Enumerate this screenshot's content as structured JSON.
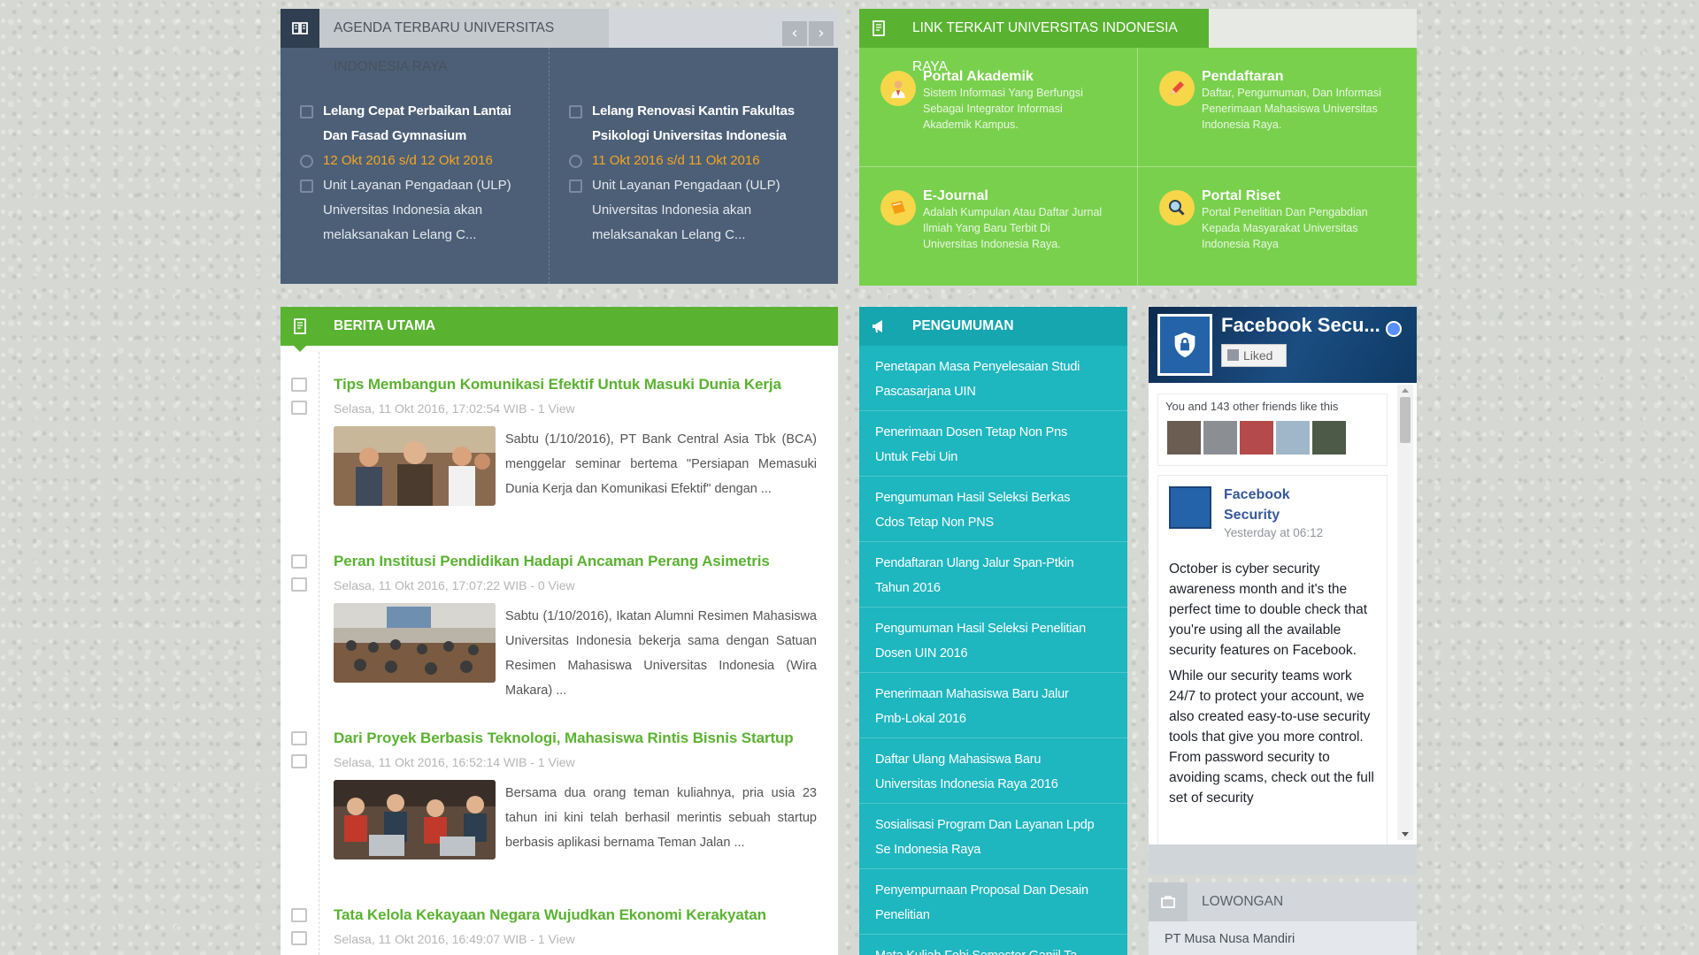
{
  "agenda": {
    "header": "AGENDA TERBARU UNIVERSITAS INDONESIA RAYA",
    "prev_icon": "‹",
    "next_icon": "›",
    "items": [
      {
        "title_line1": "Lelang Cepat Perbaikan Lantai",
        "title_line2": "Dan Fasad Gymnasium",
        "date": "12 Okt 2016 s/d 12 Okt 2016",
        "desc_line1": "Unit Layanan Pengadaan (ULP)",
        "desc_line2": "Universitas Indonesia akan",
        "desc_line3": "melaksanakan Lelang C..."
      },
      {
        "title_line1": "Lelang Renovasi Kantin Fakultas",
        "title_line2": "Psikologi Universitas Indonesia",
        "date": "11 Okt 2016 s/d 11 Okt 2016",
        "desc_line1": "Unit Layanan Pengadaan (ULP)",
        "desc_line2": "Universitas Indonesia akan",
        "desc_line3": "melaksanakan Lelang C..."
      }
    ]
  },
  "links": {
    "header": "LINK TERKAIT UNIVERSITAS INDONESIA RAYA",
    "items": [
      {
        "title": "Portal Akademik",
        "d1": "Sistem Informasi Yang Berfungsi",
        "d2": "Sebagai Integrator Informasi",
        "d3": "Akademik Kampus."
      },
      {
        "title": "Pendaftaran",
        "d1": "Daftar, Pengumuman, Dan Informasi",
        "d2": "Penerimaan Mahasiswa Universitas",
        "d3": "Indonesia Raya."
      },
      {
        "title": "E-Journal",
        "d1": "Adalah Kumpulan Atau Daftar Jurnal",
        "d2": "Ilmiah Yang Baru Terbit Di",
        "d3": "Universitas Indonesia Raya."
      },
      {
        "title": "Portal Riset",
        "d1": "Portal Penelitian Dan Pengabdian",
        "d2": "Kepada Masyarakat Universitas",
        "d3": "Indonesia Raya"
      }
    ]
  },
  "berita": {
    "header": "BERITA UTAMA",
    "items": [
      {
        "title": "Tips Membangun Komunikasi Efektif Untuk Masuki Dunia Kerja",
        "meta": "Selasa, 11 Okt 2016, 17:02:54 WIB - 1 View",
        "text": "Sabtu (1/10/2016), PT Bank Central Asia Tbk (BCA) menggelar seminar bertema \"Persiapan Memasuki Dunia Kerja dan Komunikasi Efektif\" dengan ..."
      },
      {
        "title": "Peran Institusi Pendidikan Hadapi Ancaman Perang Asimetris",
        "meta": "Selasa, 11 Okt 2016, 17:07:22 WIB - 0 View",
        "text": "Sabtu (1/10/2016), Ikatan Alumni Resimen Mahasiswa Universitas Indonesia bekerja sama dengan Satuan Resimen Mahasiswa Universitas Indonesia (Wira Makara) ..."
      },
      {
        "title": "Dari Proyek Berbasis Teknologi, Mahasiswa Rintis Bisnis Startup",
        "meta": "Selasa, 11 Okt 2016, 16:52:14 WIB - 1 View",
        "text": "Bersama dua orang teman kuliahnya, pria usia 23 tahun ini kini telah berhasil merintis sebuah startup berbasis aplikasi bernama Teman Jalan ..."
      },
      {
        "title": "Tata Kelola Kekayaan Negara Wujudkan Ekonomi Kerakyatan",
        "meta": "Selasa, 11 Okt 2016, 16:49:07 WIB - 1 View",
        "text": ""
      }
    ]
  },
  "pengumuman": {
    "header": "PENGUMUMAN",
    "items": [
      {
        "l1": "Penetapan Masa Penyelesaian Studi",
        "l2": "Pascasarjana UIN"
      },
      {
        "l1": "Penerimaan Dosen Tetap Non Pns",
        "l2": "Untuk Febi Uin"
      },
      {
        "l1": "Pengumuman Hasil Seleksi Berkas",
        "l2": "Cdos Tetap Non PNS"
      },
      {
        "l1": "Pendaftaran Ulang Jalur Span-Ptkin",
        "l2": "Tahun 2016"
      },
      {
        "l1": "Pengumuman Hasil Seleksi Penelitian",
        "l2": "Dosen UIN 2016"
      },
      {
        "l1": "Penerimaan Mahasiswa Baru Jalur",
        "l2": "Pmb-Lokal 2016"
      },
      {
        "l1": "Daftar Ulang Mahasiswa Baru",
        "l2": "Universitas Indonesia Raya 2016"
      },
      {
        "l1": "Sosialisasi Program Dan Layanan Lpdp",
        "l2": "Se Indonesia Raya"
      },
      {
        "l1": "Penyempurnaan Proposal Dan Desain",
        "l2": "Penelitian"
      },
      {
        "l1": "Mata Kuliah Febi Semester Ganjil Ta",
        "l2": ""
      }
    ]
  },
  "facebook": {
    "page_name": "Facebook Secu...",
    "liked_label": "Liked",
    "friends_text": "You and 143 other friends like this",
    "post_author_line1": "Facebook",
    "post_author_line2": "Security",
    "post_time": "Yesterday at 06:12",
    "post_p1": "October is cyber security awareness month and it's the perfect time to double check that you're using all the available security features on Facebook.",
    "post_p2": "While our security teams work 24/7 to protect your account, we also created easy-to-use security tools that give you more control. From password security to avoiding scams, check out the full set of security"
  },
  "lowongan": {
    "header": "LOWONGAN",
    "first_item": "PT Musa Nusa Mandiri"
  },
  "colors": {
    "green": "#5ab231",
    "light_green": "#79d04d",
    "slate": "#4c5f77",
    "teal": "#1eb6bf",
    "orange_date": "#f5a623"
  }
}
